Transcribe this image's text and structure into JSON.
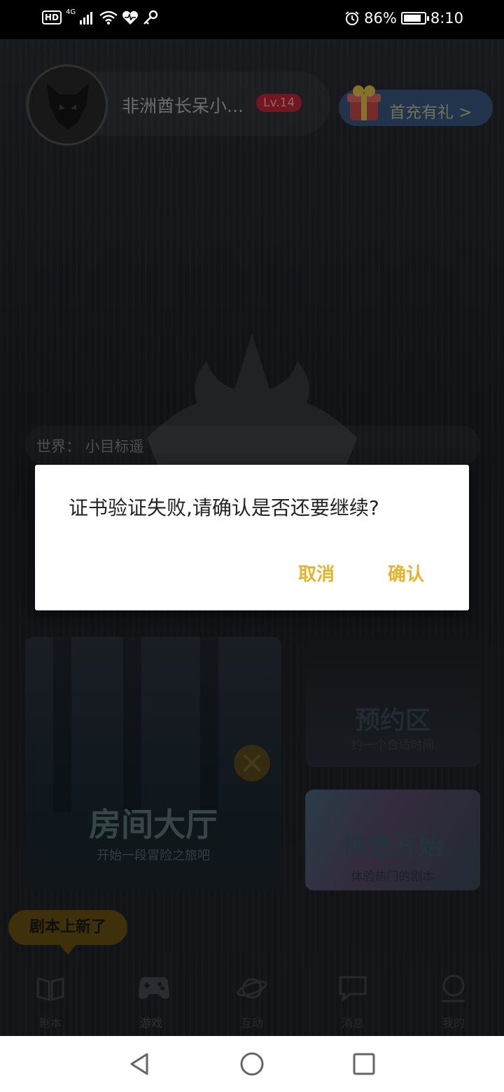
{
  "status_bar": {
    "hd": "HD",
    "network": "4G",
    "battery_percent": "86%",
    "battery_level": 0.86,
    "time": "8:10",
    "icons": [
      "hd-icon",
      "signal-icon",
      "wifi-icon",
      "health-icon",
      "key-icon",
      "alarm-icon",
      "battery-icon"
    ]
  },
  "profile": {
    "username": "非洲酋长呆小...",
    "level": "Lv.14",
    "promo_label": "首充有礼 >"
  },
  "world_bar": {
    "text": "世界：  小目标遥"
  },
  "cards": {
    "lobby_title": "房间大厅",
    "lobby_sub": "开始一段冒险之旅吧",
    "reserve_title": "预约区",
    "reserve_sub": "约一个合适时间",
    "quick_title": "快速开始",
    "quick_sub": "体验热门的剧本"
  },
  "new_tag": "剧本上新了",
  "tabs": [
    {
      "label": "剧本",
      "icon": "book-icon"
    },
    {
      "label": "游戏",
      "icon": "gamepad-icon"
    },
    {
      "label": "互动",
      "icon": "planet-icon"
    },
    {
      "label": "消息",
      "icon": "chat-icon"
    },
    {
      "label": "我的",
      "icon": "profile-icon"
    }
  ],
  "dialog": {
    "message": "证书验证失败,请确认是否还要继续?",
    "cancel": "取消",
    "confirm": "确认"
  },
  "colors": {
    "accent": "#e7b22c",
    "level_badge": "#c5283a",
    "promo": "#3a5a82"
  }
}
